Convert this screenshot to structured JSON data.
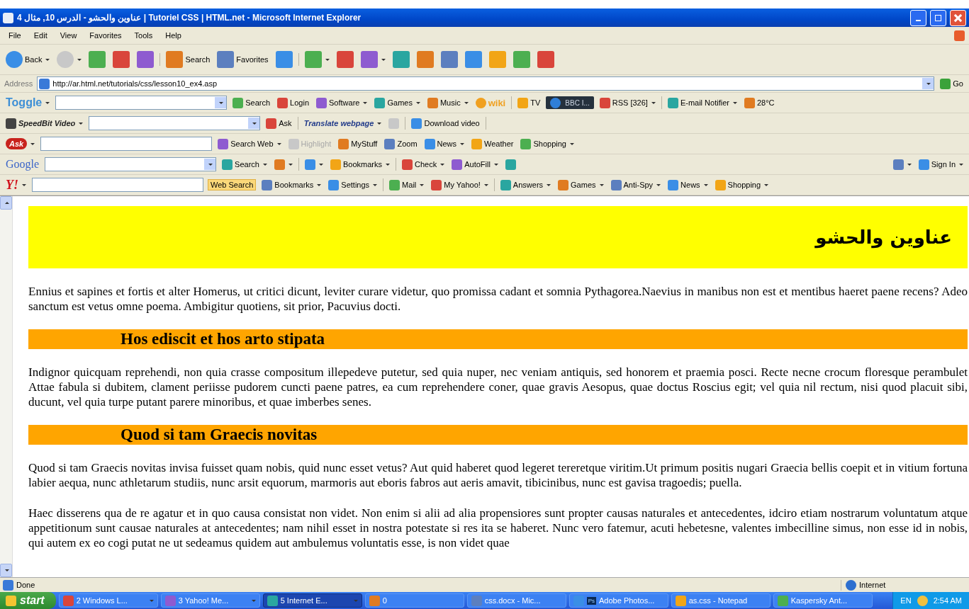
{
  "window": {
    "title": "عناوين والحشو - الدرس 10, مثال 4 | Tutoriel CSS | HTML.net - Microsoft Internet Explorer"
  },
  "menu": [
    "File",
    "Edit",
    "View",
    "Favorites",
    "Tools",
    "Help"
  ],
  "standard_buttons": [
    {
      "kind": "button",
      "label": "Back",
      "caret": true,
      "disabled": false
    },
    {
      "kind": "button",
      "caret": true,
      "disabled": true
    },
    {
      "kind": "button",
      "caret": false,
      "disabled": false
    },
    {
      "kind": "button",
      "caret": false,
      "disabled": false
    },
    {
      "kind": "button",
      "caret": false,
      "disabled": false
    },
    {
      "kind": "separator"
    },
    {
      "kind": "button",
      "label": "Search",
      "caret": false,
      "disabled": false
    },
    {
      "kind": "button",
      "label": "Favorites",
      "caret": false,
      "disabled": false
    },
    {
      "kind": "button",
      "caret": false,
      "disabled": false
    },
    {
      "kind": "separator"
    },
    {
      "kind": "button",
      "caret": true,
      "disabled": false
    },
    {
      "kind": "button",
      "caret": false,
      "disabled": false
    },
    {
      "kind": "button",
      "caret": true,
      "disabled": false
    },
    {
      "kind": "button",
      "caret": false,
      "disabled": false
    },
    {
      "kind": "button",
      "caret": false,
      "disabled": false
    },
    {
      "kind": "button",
      "caret": false,
      "disabled": false
    },
    {
      "kind": "button",
      "caret": false,
      "disabled": false
    },
    {
      "kind": "button",
      "caret": false,
      "disabled": false
    },
    {
      "kind": "button",
      "caret": false,
      "disabled": false
    },
    {
      "kind": "button",
      "caret": false,
      "disabled": false
    }
  ],
  "address": {
    "label": "Address",
    "value": "http://ar.html.net/tutorials/css/lesson10_ex4.asp",
    "go": "Go"
  },
  "toolbars": [
    {
      "items": [
        {
          "kind": "brand",
          "label": "Toggle",
          "caret": true
        },
        {
          "kind": "field",
          "dropdown": true
        },
        {
          "kind": "button",
          "label": "Search",
          "caret": false,
          "disabled": false
        },
        {
          "kind": "button",
          "label": "Login",
          "caret": false,
          "disabled": false
        },
        {
          "kind": "button",
          "label": "Software",
          "caret": true,
          "disabled": false
        },
        {
          "kind": "button",
          "label": "Games",
          "caret": true,
          "disabled": false
        },
        {
          "kind": "button",
          "label": "Music",
          "caret": true,
          "disabled": false
        },
        {
          "kind": "wiki",
          "label": "wiki"
        },
        {
          "kind": "separator"
        },
        {
          "kind": "button",
          "label": "TV",
          "caret": false,
          "disabled": false
        },
        {
          "kind": "player",
          "label": "BBC I..."
        },
        {
          "kind": "button",
          "label": "RSS [326]",
          "caret": true,
          "disabled": false
        },
        {
          "kind": "separator"
        },
        {
          "kind": "button",
          "label": "E-mail Notifier",
          "caret": true,
          "disabled": false
        },
        {
          "kind": "button",
          "label": "28°C",
          "caret": false,
          "disabled": false
        }
      ]
    },
    {
      "items": [
        {
          "kind": "brand",
          "label": "SpeedBit Video",
          "caret": true
        },
        {
          "kind": "field",
          "dropdown": true
        },
        {
          "kind": "button",
          "label": "Ask",
          "caret": false,
          "disabled": false
        },
        {
          "kind": "separator"
        },
        {
          "kind": "emph",
          "label": "Translate webpage",
          "caret": true
        },
        {
          "kind": "button",
          "caret": false,
          "disabled": true
        },
        {
          "kind": "separator"
        },
        {
          "kind": "button",
          "label": "Download video",
          "caret": false,
          "disabled": false
        },
        {
          "kind": "separator"
        }
      ]
    },
    {
      "items": [
        {
          "kind": "logo",
          "label": "Ask",
          "caret": true
        },
        {
          "kind": "field",
          "dropdown": false
        },
        {
          "kind": "button",
          "label": "Search Web",
          "caret": true,
          "disabled": false
        },
        {
          "kind": "button",
          "label": "Highlight",
          "caret": false,
          "disabled": true
        },
        {
          "kind": "button",
          "label": "MyStuff",
          "caret": false,
          "disabled": false
        },
        {
          "kind": "button",
          "label": "Zoom",
          "caret": false,
          "disabled": false
        },
        {
          "kind": "button",
          "label": "News",
          "caret": true,
          "disabled": false
        },
        {
          "kind": "button",
          "label": "Weather",
          "caret": false,
          "disabled": false
        },
        {
          "kind": "button",
          "label": "Shopping",
          "caret": true,
          "disabled": false
        }
      ]
    },
    {
      "items": [
        {
          "kind": "google",
          "label": "Google",
          "caret": false
        },
        {
          "kind": "field",
          "dropdown": true
        },
        {
          "kind": "button",
          "label": "Search",
          "caret": true,
          "disabled": false
        },
        {
          "kind": "button",
          "caret": true,
          "disabled": false
        },
        {
          "kind": "separator"
        },
        {
          "kind": "button",
          "caret": true,
          "disabled": false
        },
        {
          "kind": "button",
          "label": "Bookmarks",
          "caret": true,
          "disabled": false
        },
        {
          "kind": "separator"
        },
        {
          "kind": "button",
          "label": "Check",
          "caret": true,
          "disabled": false
        },
        {
          "kind": "button",
          "label": "AutoFill",
          "caret": true,
          "disabled": false
        },
        {
          "kind": "button",
          "caret": false,
          "disabled": false
        },
        {
          "kind": "spacer"
        },
        {
          "kind": "button",
          "caret": true,
          "disabled": false
        },
        {
          "kind": "button",
          "label": "Sign In",
          "caret": true,
          "disabled": false
        }
      ]
    },
    {
      "items": [
        {
          "kind": "yahoo",
          "label": "Y!",
          "caret": true
        },
        {
          "kind": "field",
          "dropdown": false
        },
        {
          "kind": "highlight",
          "label": "Web Search"
        },
        {
          "kind": "button",
          "label": "Bookmarks",
          "caret": true,
          "disabled": false
        },
        {
          "kind": "button",
          "label": "Settings",
          "caret": true,
          "disabled": false
        },
        {
          "kind": "separator"
        },
        {
          "kind": "button",
          "label": "Mail",
          "caret": true,
          "disabled": false
        },
        {
          "kind": "button",
          "label": "My Yahoo!",
          "caret": true,
          "disabled": false
        },
        {
          "kind": "separator"
        },
        {
          "kind": "button",
          "label": "Answers",
          "caret": true,
          "disabled": false
        },
        {
          "kind": "button",
          "label": "Games",
          "caret": true,
          "disabled": false
        },
        {
          "kind": "button",
          "label": "Anti-Spy",
          "caret": true,
          "disabled": false
        },
        {
          "kind": "button",
          "label": "News",
          "caret": true,
          "disabled": false
        },
        {
          "kind": "button",
          "label": "Shopping",
          "caret": true,
          "disabled": false
        }
      ]
    }
  ],
  "page": {
    "banner": "عناوين والحشو",
    "blocks": [
      {
        "kind": "paragraph",
        "text": "Ennius et sapines et fortis et alter Homerus, ut critici dicunt, leviter curare videtur, quo promissa cadant et somnia Pythagorea.Naevius in manibus non est et mentibus haeret paene recens? Adeo sanctum est vetus omne poema. Ambigitur quotiens, sit prior, Pacuvius docti."
      },
      {
        "kind": "heading",
        "text": "Hos ediscit et hos arto stipata"
      },
      {
        "kind": "paragraph",
        "text": "Indignor quicquam reprehendi, non quia crasse compositum illepedeve putetur, sed quia nuper, nec veniam antiquis, sed honorem et praemia posci. Recte necne crocum floresque perambulet Attae fabula si dubitem, clament periisse pudorem cuncti paene patres, ea cum reprehendere coner, quae gravis Aesopus, quae doctus Roscius egit; vel quia nil rectum, nisi quod placuit sibi, ducunt, vel quia turpe putant parere minoribus, et quae imberbes senes."
      },
      {
        "kind": "heading",
        "text": "Quod si tam Graecis novitas"
      },
      {
        "kind": "paragraph",
        "text": "Quod si tam Graecis novitas invisa fuisset quam nobis, quid nunc esset vetus? Aut quid haberet quod legeret tereretque viritim.Ut primum positis nugari Graecia bellis coepit et in vitium fortuna labier aequa, nunc athletarum studiis, nunc arsit equorum, marmoris aut eboris fabros aut aeris amavit, tibicinibus, nunc est gavisa tragoedis; puella."
      },
      {
        "kind": "paragraph",
        "text": "Haec disserens qua de re agatur et in quo causa consistat non videt. Non enim si alii ad alia propensiores sunt propter causas naturales et antecedentes, idciro etiam nostrarum voluntatum atque appetitionum sunt causae naturales at antecedentes; nam nihil esset in nostra potestate si res ita se haberet. Nunc vero fatemur, acuti hebetesne, valentes imbecilline simus, non esse id in nobis, qui autem ex eo cogi putat ne ut sedeamus quidem aut ambulemus voluntatis esse, is non videt quae"
      }
    ]
  },
  "status_bar": {
    "text": "Done",
    "zone": "Internet"
  },
  "taskbar": {
    "start": "start",
    "tasks": [
      {
        "label": "2 Windows L...",
        "caret": true,
        "selected": false
      },
      {
        "label": "3 Yahoo! Me...",
        "caret": true,
        "selected": false
      },
      {
        "label": "5 Internet E...",
        "caret": true,
        "selected": true
      },
      {
        "label": "0",
        "caret": false,
        "selected": false
      },
      {
        "label": "css.docx - Mic...",
        "caret": false,
        "selected": false
      },
      {
        "label": "Adobe Photos...",
        "badge": "Ps",
        "caret": false,
        "selected": false
      },
      {
        "label": "as.css - Notepad",
        "caret": false,
        "selected": false
      },
      {
        "label": "Kaspersky Ant...",
        "caret": false,
        "selected": false
      }
    ],
    "language": "EN",
    "time": "2:54 AM"
  }
}
